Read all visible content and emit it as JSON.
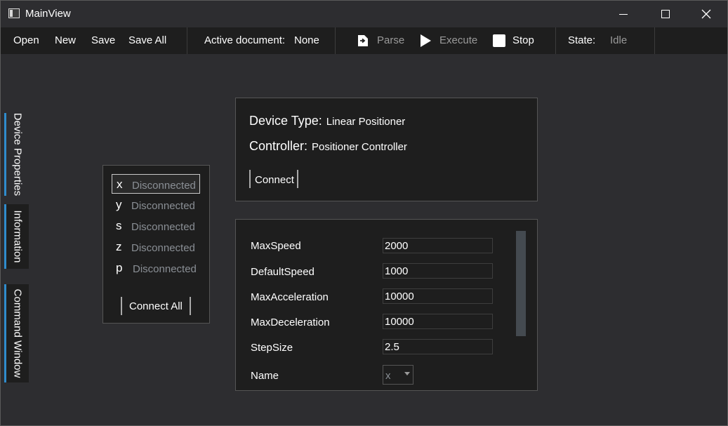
{
  "window": {
    "title": "MainView"
  },
  "toolbar": {
    "open": "Open",
    "new": "New",
    "save": "Save",
    "save_all": "Save All",
    "active_document_label": "Active document:",
    "active_document_value": "None",
    "parse": "Parse",
    "execute": "Execute",
    "stop": "Stop",
    "state_label": "State:",
    "state_value": "Idle"
  },
  "side_tabs": [
    "Device Properties",
    "Information",
    "Command Window"
  ],
  "axes": {
    "items": [
      {
        "letter": "x",
        "status": "Disconnected",
        "selected": true
      },
      {
        "letter": "y",
        "status": "Disconnected"
      },
      {
        "letter": "s",
        "status": "Disconnected"
      },
      {
        "letter": "z",
        "status": "Disconnected"
      },
      {
        "letter": "p",
        "status": "Disconnected"
      }
    ],
    "connect_all": "Connect All"
  },
  "device": {
    "type_label": "Device Type:",
    "type_value": "Linear Positioner",
    "controller_label": "Controller:",
    "controller_value": "Positioner Controller",
    "connect": "Connect"
  },
  "properties": [
    {
      "label": "MaxSpeed",
      "value": "2000"
    },
    {
      "label": "DefaultSpeed",
      "value": "1000"
    },
    {
      "label": "MaxAcceleration",
      "value": "10000"
    },
    {
      "label": "MaxDeceleration",
      "value": "10000"
    },
    {
      "label": "StepSize",
      "value": "2.5"
    }
  ],
  "name_field": {
    "label": "Name",
    "value": "x"
  },
  "colors": {
    "accent": "#2f8ccc",
    "background": "#2d2d30",
    "panel": "#1e1e1e",
    "dim_text": "#8a8f95"
  }
}
